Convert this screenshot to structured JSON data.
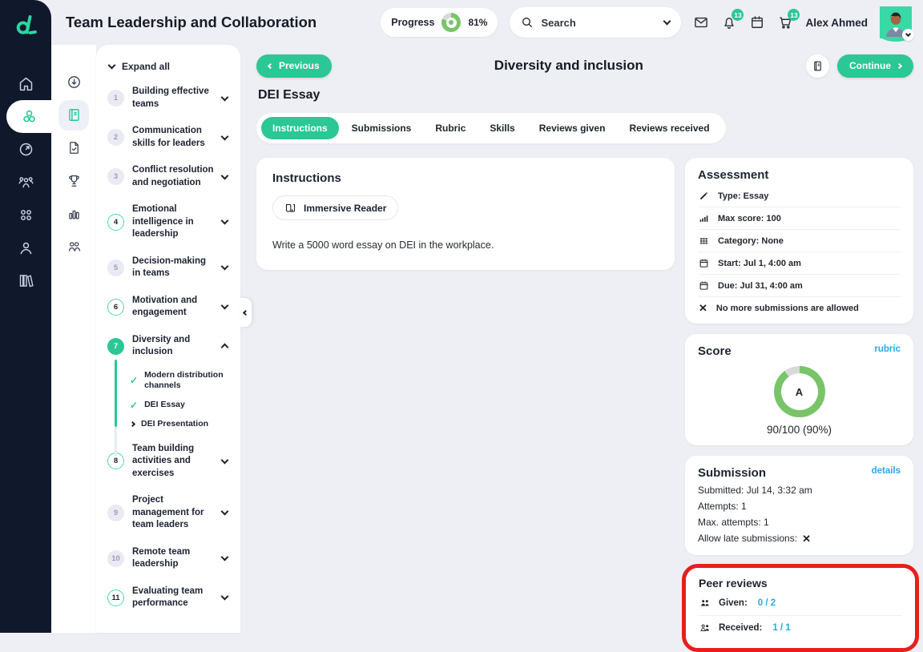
{
  "colors": {
    "accent": "#2bc795",
    "navy": "#10182b",
    "link_blue": "#2ba7e8",
    "donut_green": "#79c468",
    "annotation_red": "#e81d1d"
  },
  "header": {
    "course_title": "Team Leadership and Collaboration",
    "progress_label": "Progress",
    "progress_percent": 81,
    "progress_percent_label": "81%",
    "search_placeholder": "Search",
    "notification_count": "13",
    "cart_count": "13",
    "user_name": "Alex Ahmed"
  },
  "nav_sidebar": {
    "icons": [
      "home-icon",
      "modules-icon",
      "dashboard-icon",
      "groups-icon",
      "apps-icon",
      "profile-icon",
      "library-icon"
    ],
    "active_icon": "modules-icon"
  },
  "tool_rail": {
    "icons": [
      "circle-down-icon",
      "book-icon",
      "assignment-check-icon",
      "trophy-icon",
      "bar-chart-icon",
      "users-icon"
    ],
    "active_icon": "book-icon"
  },
  "module_panel": {
    "expand_all": "Expand all",
    "modules": [
      {
        "num": "1",
        "title": "Building effective teams",
        "state": "default"
      },
      {
        "num": "2",
        "title": "Communication skills for leaders",
        "state": "default"
      },
      {
        "num": "3",
        "title": "Conflict resolution and negotiation",
        "state": "default"
      },
      {
        "num": "4",
        "title": "Emotional intelligence in leadership",
        "state": "ring"
      },
      {
        "num": "5",
        "title": "Decision-making in teams",
        "state": "default"
      },
      {
        "num": "6",
        "title": "Motivation and engagement",
        "state": "ring"
      },
      {
        "num": "7",
        "title": "Diversity and inclusion",
        "state": "current",
        "expanded": true,
        "subitems": [
          {
            "title": "Modern distribution channels",
            "status": "done"
          },
          {
            "title": "DEI Essay",
            "status": "done",
            "active": true
          },
          {
            "title": "DEI Presentation",
            "status": "next"
          }
        ]
      },
      {
        "num": "8",
        "title": "Team building activities and exercises",
        "state": "ring"
      },
      {
        "num": "9",
        "title": "Project management for team leaders",
        "state": "default"
      },
      {
        "num": "10",
        "title": "Remote team leadership",
        "state": "default"
      },
      {
        "num": "11",
        "title": "Evaluating team performance",
        "state": "ring"
      }
    ]
  },
  "lesson_nav": {
    "previous": "Previous",
    "continue": "Continue",
    "module_title": "Diversity and inclusion",
    "lesson_title": "DEI Essay"
  },
  "tabs": {
    "items": [
      "Instructions",
      "Submissions",
      "Rubric",
      "Skills",
      "Reviews given",
      "Reviews received"
    ],
    "active": "Instructions"
  },
  "instructions": {
    "heading": "Instructions",
    "immersive_reader": "Immersive Reader",
    "body": "Write a 5000 word essay on DEI in the workplace."
  },
  "assessment": {
    "heading": "Assessment",
    "rows": [
      {
        "icon": "pencil-icon",
        "text": "Type: Essay"
      },
      {
        "icon": "signal-bars-icon",
        "text": "Max score: 100"
      },
      {
        "icon": "category-grid-icon",
        "text": "Category: None"
      },
      {
        "icon": "calendar-icon",
        "text": "Start: Jul 1, 4:00 am"
      },
      {
        "icon": "calendar-icon",
        "text": "Due: Jul 31, 4:00 am"
      },
      {
        "icon": "cross-icon",
        "text": "No more submissions are allowed"
      }
    ]
  },
  "score": {
    "heading": "Score",
    "rubric_link": "rubric",
    "grade": "A",
    "percent": 90,
    "display": "90/100 (90%)"
  },
  "submission": {
    "heading": "Submission",
    "details_link": "details",
    "submitted": "Submitted: Jul 14, 3:32 am",
    "attempts": "Attempts: 1",
    "max_attempts": "Max. attempts: 1",
    "allow_late": "Allow late submissions:"
  },
  "peer_reviews": {
    "heading": "Peer reviews",
    "given_label": "Given:",
    "given_value": "0 / 2",
    "received_label": "Received:",
    "received_value": "1 / 1"
  },
  "glyphs": {
    "check": "✓",
    "cross": "✕"
  }
}
